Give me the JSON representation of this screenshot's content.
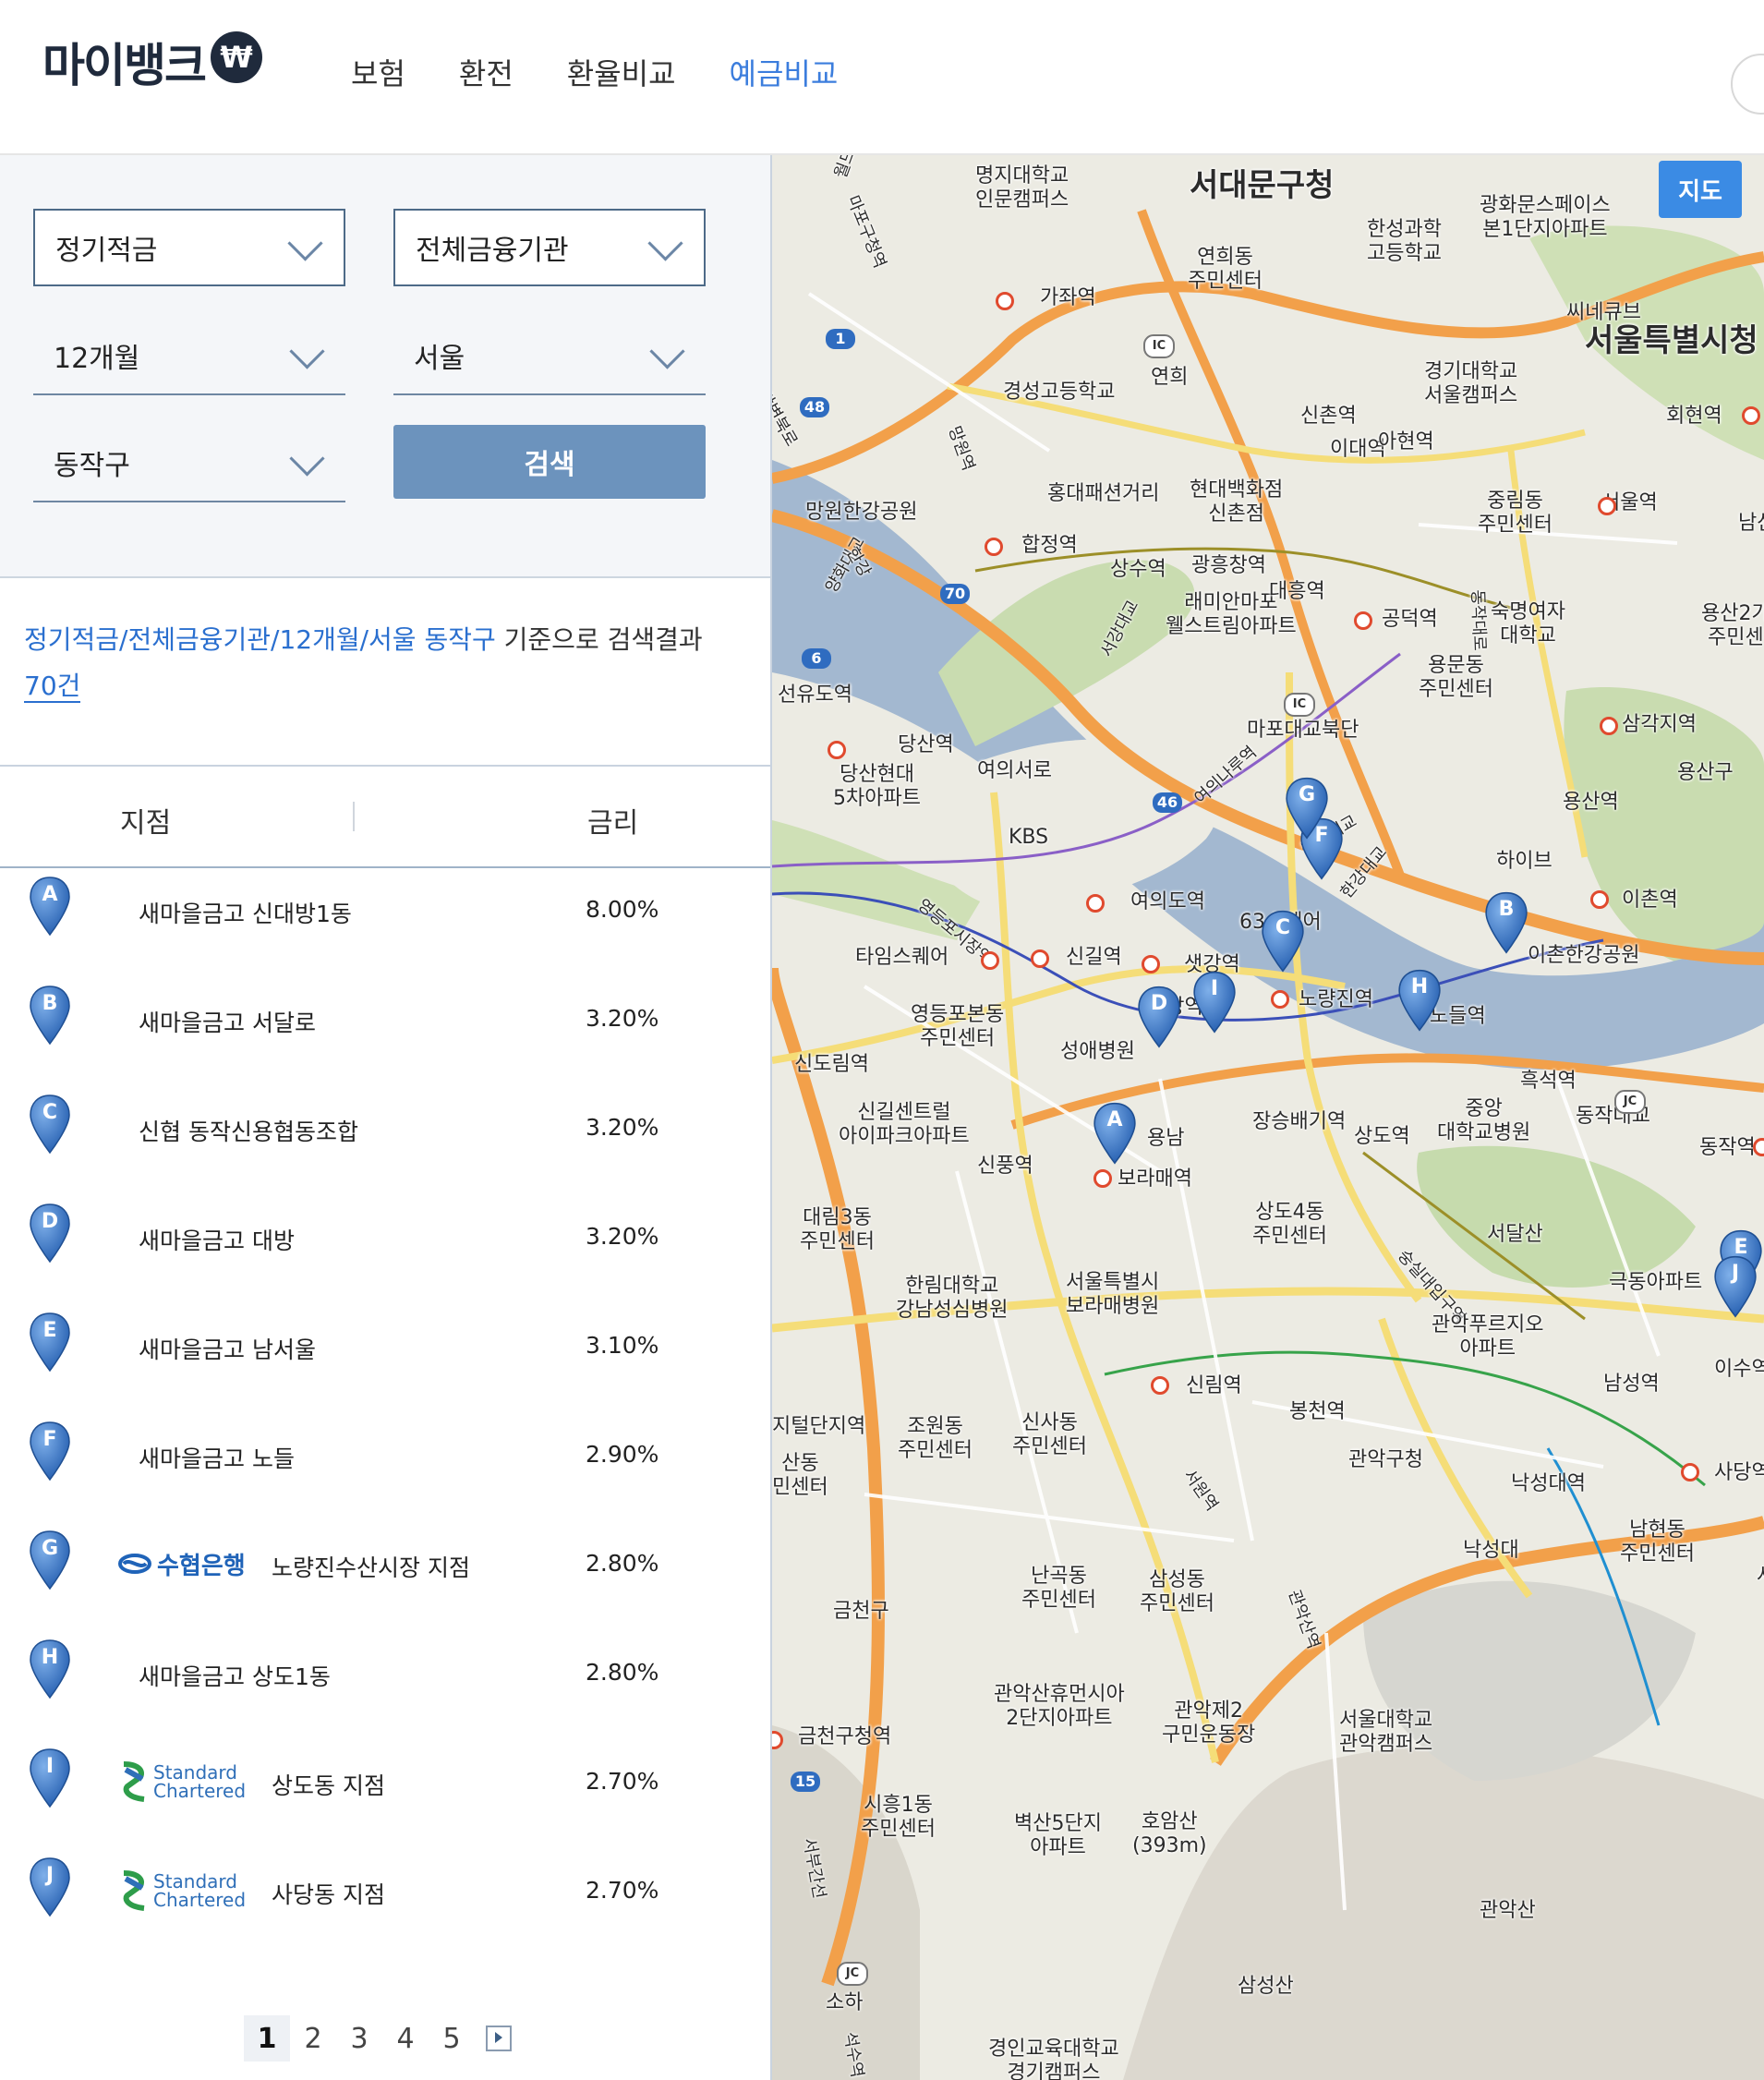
{
  "header": {
    "logo_text": "마이뱅크",
    "logo_coin": "₩",
    "nav": [
      {
        "label": "보험",
        "active": false
      },
      {
        "label": "환전",
        "active": false
      },
      {
        "label": "환율비교",
        "active": false
      },
      {
        "label": "예금비교",
        "active": true
      }
    ]
  },
  "filters": {
    "product": "정기적금",
    "institution": "전체금융기관",
    "period": "12개월",
    "city": "서울",
    "district": "동작구",
    "search_label": "검색"
  },
  "summary": {
    "query": "정기적금/전체금융기관/12개월/서울 동작구",
    "suffix": " 기준으로 검색결과",
    "count": "70건"
  },
  "table": {
    "columns": [
      "지점",
      "금리"
    ],
    "rows": [
      {
        "marker": "A",
        "bank_logo": "",
        "name": "새마을금고 신대방1동",
        "rate": "8.00%"
      },
      {
        "marker": "B",
        "bank_logo": "",
        "name": "새마을금고 서달로",
        "rate": "3.20%"
      },
      {
        "marker": "C",
        "bank_logo": "",
        "name": "신협 동작신용협동조합",
        "rate": "3.20%"
      },
      {
        "marker": "D",
        "bank_logo": "",
        "name": "새마을금고 대방",
        "rate": "3.20%"
      },
      {
        "marker": "E",
        "bank_logo": "",
        "name": "새마을금고 남서울",
        "rate": "3.10%"
      },
      {
        "marker": "F",
        "bank_logo": "",
        "name": "새마을금고 노들",
        "rate": "2.90%"
      },
      {
        "marker": "G",
        "bank_logo": "수협은행",
        "name": "노량진수산시장 지점",
        "rate": "2.80%"
      },
      {
        "marker": "H",
        "bank_logo": "",
        "name": "새마을금고 상도1동",
        "rate": "2.80%"
      },
      {
        "marker": "I",
        "bank_logo": "Standard Chartered",
        "name": "상도동 지점",
        "rate": "2.70%"
      },
      {
        "marker": "J",
        "bank_logo": "Standard Chartered",
        "name": "사당동 지점",
        "rate": "2.70%"
      }
    ]
  },
  "pagination": {
    "pages": [
      "1",
      "2",
      "3",
      "4",
      "5"
    ],
    "current": "1"
  },
  "map": {
    "button_label": "지도",
    "labels": {
      "l1": "명지대학교\n인문캠퍼스",
      "l2": "서대문구청",
      "l3": "연희동\n주민센터",
      "l4": "한성과학\n고등학교",
      "l5": "광화문스페이스\n본1단지아파트",
      "l6": "씨네큐브",
      "l7": "서울특별시청",
      "l8": "가좌역",
      "l9": "경성고등학교",
      "l10": "연희",
      "l11": "경기대학교\n서울캠퍼스",
      "l12": "신촌역",
      "l13": "이대역",
      "l14": "아현역",
      "l15": "회현역",
      "l16": "홍대패션거리",
      "l17": "현대백화점\n신촌점",
      "l18": "중림동\n주민센터",
      "l19": "서울역",
      "l20": "남산서",
      "l21": "망원한강공원",
      "l22": "합정역",
      "l23": "상수역",
      "l24": "광흥창역",
      "l25": "래미안마포\n웰스트림아파트",
      "l26": "대흥역",
      "l27": "공덕역",
      "l28": "숙명여자\n대학교",
      "l29": "용산2가\n주민센",
      "l30": "용문동\n주민센터",
      "l31": "마포대교북단",
      "l32": "삼각지역",
      "l33": "선유도역",
      "l34": "당산역",
      "l35": "당산현대\n5차아파트",
      "l36": "여의서로",
      "l37": "KBS",
      "l38": "여의나루역",
      "l39": "원효대교",
      "l40": "용산역",
      "l41": "용산구",
      "l42": "하이브",
      "l43": "이촌역",
      "l44": "영등포시장역",
      "l45": "여의도역",
      "l46": "63스퀘어",
      "l47": "타임스퀘어",
      "l48": "신길역",
      "l49": "샛강역",
      "l50": "노량진역",
      "l51": "노들역",
      "l52": "이촌한강공원",
      "l53": "영등포본동\n주민센터",
      "l54": "대방역",
      "l55": "성애병원",
      "l56": "신도림역",
      "l57": "흑석역",
      "l58": "중앙\n대학교병원",
      "l59": "동작대교",
      "l60": "동작역",
      "l61": "신길센트럴\n아이파크아파트",
      "l62": "장승배기역",
      "l63": "신풍역",
      "l64": "보라매역",
      "l65": "상도역",
      "l66": "대림3동\n주민센터",
      "l67": "상도4동\n주민센터",
      "l68": "숭실대입구역",
      "l69": "서달산",
      "l70": "한림대학교\n강남성심병원",
      "l71": "서울특별시\n보라매병원",
      "l72": "극동아파트",
      "l73": "관악푸르지오\n아파트",
      "l74": "신림역",
      "l75": "봉천역",
      "l76": "남성역",
      "l77": "이수역",
      "l78": "지털단지역",
      "l79": "조원동\n주민센터",
      "l80": "신사동\n주민센터",
      "l81": "관악구청",
      "l82": "낙성대역",
      "l83": "사당역",
      "l84": "산동\n민센터",
      "l85": "서원역",
      "l86": "낙성대",
      "l87": "남현동\n주민센터",
      "l88": "사당",
      "l89": "금천구",
      "l90": "난곡동\n주민센터",
      "l91": "삼성동\n주민센터",
      "l92": "관악산역",
      "l93": "관악산휴먼시아\n2단지아파트",
      "l94": "관악제2\n구민운동장",
      "l95": "서울대학교\n관악캠퍼스",
      "l96": "금천구청역",
      "l97": "시흥1동\n주민센터",
      "l98": "벽산5단지\n아파트",
      "l99": "호암산\n(393m)",
      "l100": "관악산",
      "l101": "삼성산",
      "l102": "소하",
      "l103": "석수역",
      "l104": "경인교육대학교\n경기캠퍼스",
      "l105": "마포구청역",
      "l106": "망원역",
      "l107": "월드컵경기장역",
      "l108": "강변북로",
      "l109": "양화대교",
      "l110": "서강대교",
      "l111": "한강대교",
      "l112": "한강",
      "l113": "동작대로",
      "l114": "서부간선",
      "l115": "용남"
    },
    "road_numbers": [
      "1",
      "48",
      "70",
      "6",
      "46",
      "15"
    ],
    "road_badges": [
      "IC",
      "IC",
      "JC",
      "JC"
    ],
    "pins": [
      "A",
      "B",
      "C",
      "D",
      "E",
      "F",
      "G",
      "H",
      "I",
      "J"
    ]
  },
  "colors": {
    "brand_dark": "#1f2a3c",
    "accent_blue": "#3b7ddd",
    "search_button": "#6c93bd",
    "pin_blue": "#3a78c9",
    "map_river": "#a3b8d0",
    "map_park": "#c9dcb0",
    "map_road_orange": "#f2a04a",
    "map_road_yellow": "#f5dd78"
  }
}
